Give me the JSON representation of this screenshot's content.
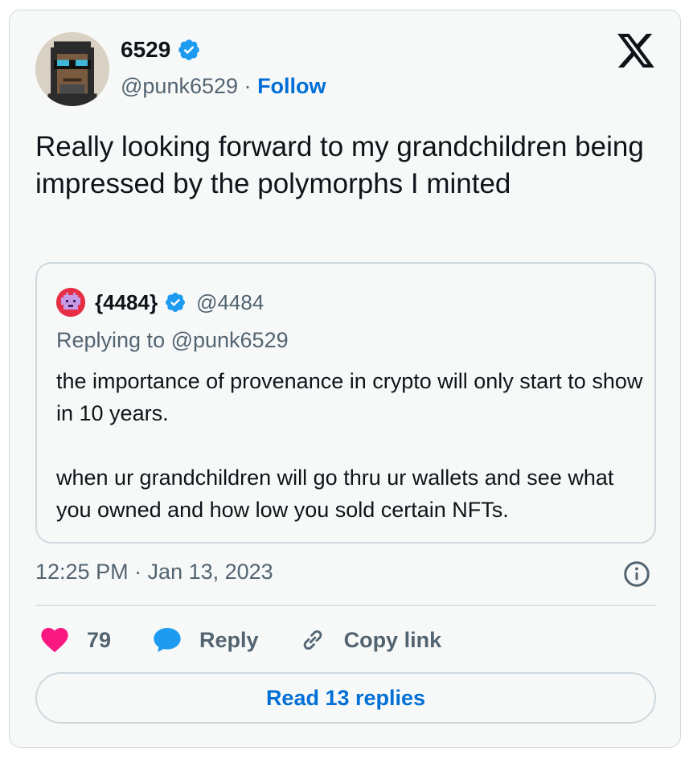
{
  "author": {
    "name": "6529",
    "handle": "@punk6529",
    "separator": "·",
    "follow_label": "Follow",
    "verified": true
  },
  "tweet": {
    "text": "Really looking forward to my grandchildren being impressed by the polymorphs I minted",
    "timestamp": "12:25 PM · Jan 13, 2023"
  },
  "quoted": {
    "name": "{4484}",
    "handle": "@4484",
    "replying_to": "Replying to @punk6529",
    "text": "the importance of provenance in crypto will only start to show in 10 years.\n\nwhen ur grandchildren will go thru ur wallets and see what you owned and how low you sold certain NFTs."
  },
  "actions": {
    "like_count": "79",
    "reply_label": "Reply",
    "copy_link_label": "Copy link"
  },
  "read_replies_label": "Read 13 replies",
  "colors": {
    "accent": "#006fd6",
    "verified": "#1d9bf0",
    "heart": "#f91880",
    "text_secondary": "#536471",
    "card_background": "#f7f9f9",
    "border": "#cfd9de"
  },
  "icons": {
    "verified": "verified-badge-icon",
    "logo": "x-logo-icon",
    "info": "info-icon",
    "like": "heart-icon",
    "reply": "speech-bubble-icon",
    "copy": "link-icon"
  }
}
